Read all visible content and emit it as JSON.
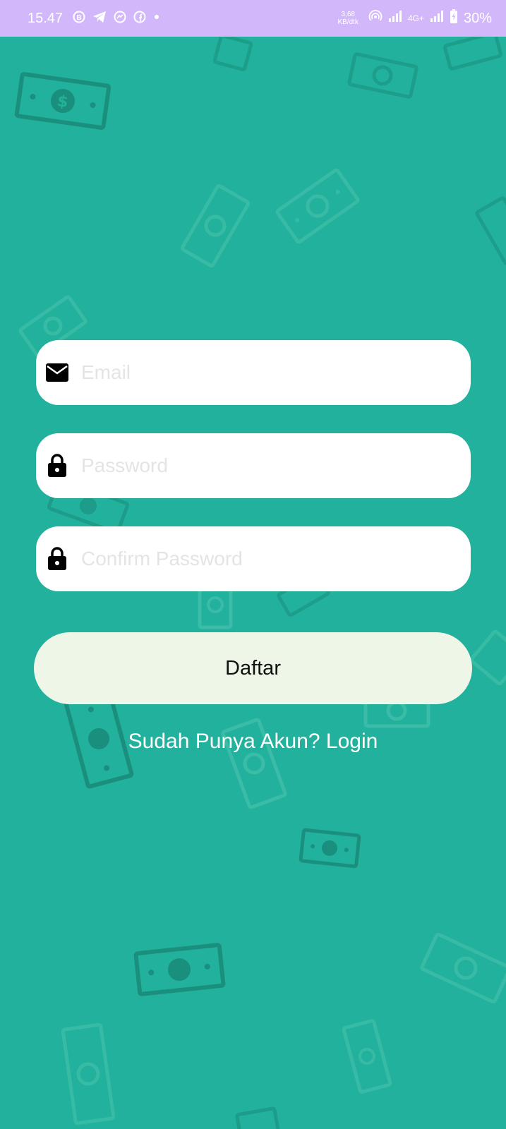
{
  "status_bar": {
    "time": "15.47",
    "notification_icons": [
      "b-icon",
      "telegram-icon",
      "messenger-icon",
      "facebook-icon",
      "dot-icon"
    ],
    "net_speed_value": "3,68",
    "net_speed_unit": "KB/dtk",
    "network_type": "4G+",
    "battery": "30%"
  },
  "form": {
    "email_placeholder": "Email",
    "password_placeholder": "Password",
    "confirm_password_placeholder": "Confirm Password"
  },
  "actions": {
    "register_label": "Daftar",
    "login_link": "Sudah Punya Akun? Login"
  },
  "colors": {
    "status_bar": "#d2b8fb",
    "background": "#21b19c",
    "field": "#ffffff",
    "button": "#eef6e7"
  }
}
